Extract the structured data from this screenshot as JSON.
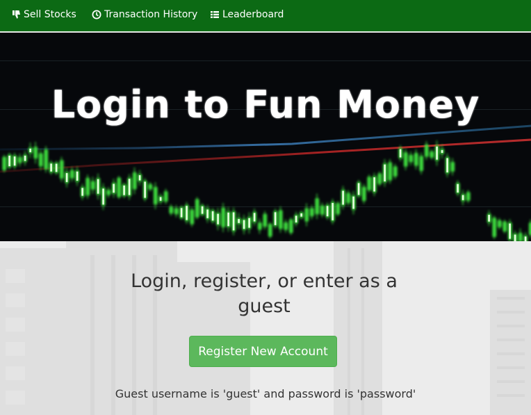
{
  "nav": {
    "items": [
      {
        "label": "Sell Stocks",
        "icon": "thumbs-down-icon"
      },
      {
        "label": "Transaction History",
        "icon": "clock-icon"
      },
      {
        "label": "Leaderboard",
        "icon": "list-icon"
      }
    ]
  },
  "hero": {
    "title": "Login to Fun Money"
  },
  "main": {
    "heading": "Login, register, or enter as a guest",
    "register_label": "Register New Account",
    "guest_note": "Guest username is 'guest' and password is 'password'"
  },
  "colors": {
    "navbar": "#0c6a14",
    "button": "#5cb85c",
    "candle_green": "#39d83a"
  }
}
